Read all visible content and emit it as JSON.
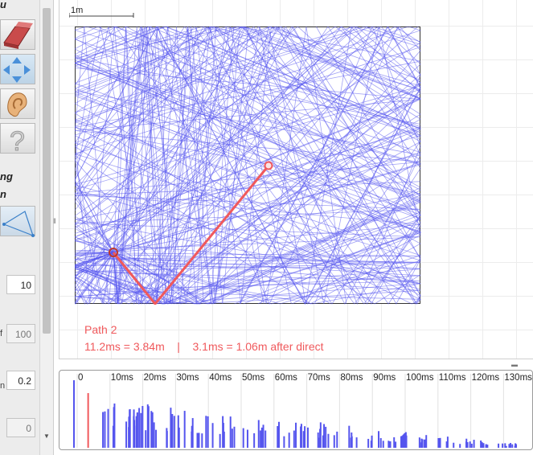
{
  "toolbar": {
    "menu_label_fragment": "u",
    "tools": [
      {
        "name": "eraser-tool",
        "icon": "eraser-icon"
      },
      {
        "name": "move-tool",
        "icon": "move-arrows-icon",
        "active": true
      },
      {
        "name": "listener-tool",
        "icon": "ear-icon"
      },
      {
        "name": "help-tool",
        "icon": "question-mark-icon"
      }
    ],
    "section_labels": [
      "ng",
      "n"
    ],
    "path_tool_icon": "path-triangle-icon"
  },
  "inputs": {
    "field_1": "10",
    "field_2": "100",
    "field_2_label_fragment": "f",
    "field_3": "0.2",
    "field_3_label_fragment": "n",
    "field_4": "0"
  },
  "scale_bar": {
    "label": "1m"
  },
  "path_info": {
    "title": "Path 2",
    "detail": "11.2ms = 3.84m    |    3.1ms = 1.06m after direct"
  },
  "colors": {
    "rays": "#5555ee",
    "highlight_path": "#f0595c",
    "source": "#c0392b",
    "listener": "#f0595c"
  },
  "echogram": {
    "ticks": [
      "0",
      "10ms",
      "20ms",
      "30ms",
      "40ms",
      "50ms",
      "60ms",
      "70ms",
      "80ms",
      "90ms",
      "100ms",
      "110ms",
      "120ms",
      "130ms"
    ],
    "highlight_time_ms": 3.1
  }
}
